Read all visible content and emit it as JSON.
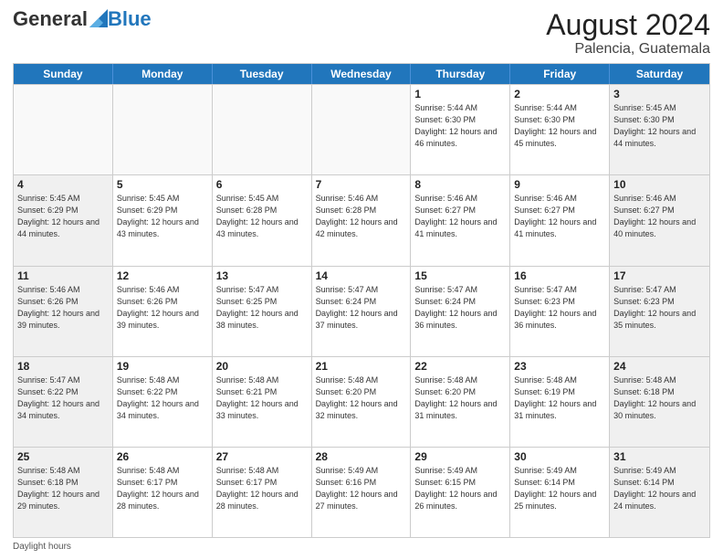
{
  "header": {
    "logo_general": "General",
    "logo_blue": "Blue",
    "month_year": "August 2024",
    "location": "Palencia, Guatemala"
  },
  "days_of_week": [
    "Sunday",
    "Monday",
    "Tuesday",
    "Wednesday",
    "Thursday",
    "Friday",
    "Saturday"
  ],
  "footer_text": "Daylight hours",
  "weeks": [
    [
      {
        "day": "",
        "info": "",
        "empty": true
      },
      {
        "day": "",
        "info": "",
        "empty": true
      },
      {
        "day": "",
        "info": "",
        "empty": true
      },
      {
        "day": "",
        "info": "",
        "empty": true
      },
      {
        "day": "1",
        "info": "Sunrise: 5:44 AM\nSunset: 6:30 PM\nDaylight: 12 hours\nand 46 minutes.",
        "empty": false
      },
      {
        "day": "2",
        "info": "Sunrise: 5:44 AM\nSunset: 6:30 PM\nDaylight: 12 hours\nand 45 minutes.",
        "empty": false
      },
      {
        "day": "3",
        "info": "Sunrise: 5:45 AM\nSunset: 6:30 PM\nDaylight: 12 hours\nand 44 minutes.",
        "empty": false
      }
    ],
    [
      {
        "day": "4",
        "info": "Sunrise: 5:45 AM\nSunset: 6:29 PM\nDaylight: 12 hours\nand 44 minutes.",
        "empty": false
      },
      {
        "day": "5",
        "info": "Sunrise: 5:45 AM\nSunset: 6:29 PM\nDaylight: 12 hours\nand 43 minutes.",
        "empty": false
      },
      {
        "day": "6",
        "info": "Sunrise: 5:45 AM\nSunset: 6:28 PM\nDaylight: 12 hours\nand 43 minutes.",
        "empty": false
      },
      {
        "day": "7",
        "info": "Sunrise: 5:46 AM\nSunset: 6:28 PM\nDaylight: 12 hours\nand 42 minutes.",
        "empty": false
      },
      {
        "day": "8",
        "info": "Sunrise: 5:46 AM\nSunset: 6:27 PM\nDaylight: 12 hours\nand 41 minutes.",
        "empty": false
      },
      {
        "day": "9",
        "info": "Sunrise: 5:46 AM\nSunset: 6:27 PM\nDaylight: 12 hours\nand 41 minutes.",
        "empty": false
      },
      {
        "day": "10",
        "info": "Sunrise: 5:46 AM\nSunset: 6:27 PM\nDaylight: 12 hours\nand 40 minutes.",
        "empty": false
      }
    ],
    [
      {
        "day": "11",
        "info": "Sunrise: 5:46 AM\nSunset: 6:26 PM\nDaylight: 12 hours\nand 39 minutes.",
        "empty": false
      },
      {
        "day": "12",
        "info": "Sunrise: 5:46 AM\nSunset: 6:26 PM\nDaylight: 12 hours\nand 39 minutes.",
        "empty": false
      },
      {
        "day": "13",
        "info": "Sunrise: 5:47 AM\nSunset: 6:25 PM\nDaylight: 12 hours\nand 38 minutes.",
        "empty": false
      },
      {
        "day": "14",
        "info": "Sunrise: 5:47 AM\nSunset: 6:24 PM\nDaylight: 12 hours\nand 37 minutes.",
        "empty": false
      },
      {
        "day": "15",
        "info": "Sunrise: 5:47 AM\nSunset: 6:24 PM\nDaylight: 12 hours\nand 36 minutes.",
        "empty": false
      },
      {
        "day": "16",
        "info": "Sunrise: 5:47 AM\nSunset: 6:23 PM\nDaylight: 12 hours\nand 36 minutes.",
        "empty": false
      },
      {
        "day": "17",
        "info": "Sunrise: 5:47 AM\nSunset: 6:23 PM\nDaylight: 12 hours\nand 35 minutes.",
        "empty": false
      }
    ],
    [
      {
        "day": "18",
        "info": "Sunrise: 5:47 AM\nSunset: 6:22 PM\nDaylight: 12 hours\nand 34 minutes.",
        "empty": false
      },
      {
        "day": "19",
        "info": "Sunrise: 5:48 AM\nSunset: 6:22 PM\nDaylight: 12 hours\nand 34 minutes.",
        "empty": false
      },
      {
        "day": "20",
        "info": "Sunrise: 5:48 AM\nSunset: 6:21 PM\nDaylight: 12 hours\nand 33 minutes.",
        "empty": false
      },
      {
        "day": "21",
        "info": "Sunrise: 5:48 AM\nSunset: 6:20 PM\nDaylight: 12 hours\nand 32 minutes.",
        "empty": false
      },
      {
        "day": "22",
        "info": "Sunrise: 5:48 AM\nSunset: 6:20 PM\nDaylight: 12 hours\nand 31 minutes.",
        "empty": false
      },
      {
        "day": "23",
        "info": "Sunrise: 5:48 AM\nSunset: 6:19 PM\nDaylight: 12 hours\nand 31 minutes.",
        "empty": false
      },
      {
        "day": "24",
        "info": "Sunrise: 5:48 AM\nSunset: 6:18 PM\nDaylight: 12 hours\nand 30 minutes.",
        "empty": false
      }
    ],
    [
      {
        "day": "25",
        "info": "Sunrise: 5:48 AM\nSunset: 6:18 PM\nDaylight: 12 hours\nand 29 minutes.",
        "empty": false
      },
      {
        "day": "26",
        "info": "Sunrise: 5:48 AM\nSunset: 6:17 PM\nDaylight: 12 hours\nand 28 minutes.",
        "empty": false
      },
      {
        "day": "27",
        "info": "Sunrise: 5:48 AM\nSunset: 6:17 PM\nDaylight: 12 hours\nand 28 minutes.",
        "empty": false
      },
      {
        "day": "28",
        "info": "Sunrise: 5:49 AM\nSunset: 6:16 PM\nDaylight: 12 hours\nand 27 minutes.",
        "empty": false
      },
      {
        "day": "29",
        "info": "Sunrise: 5:49 AM\nSunset: 6:15 PM\nDaylight: 12 hours\nand 26 minutes.",
        "empty": false
      },
      {
        "day": "30",
        "info": "Sunrise: 5:49 AM\nSunset: 6:14 PM\nDaylight: 12 hours\nand 25 minutes.",
        "empty": false
      },
      {
        "day": "31",
        "info": "Sunrise: 5:49 AM\nSunset: 6:14 PM\nDaylight: 12 hours\nand 24 minutes.",
        "empty": false
      }
    ]
  ]
}
